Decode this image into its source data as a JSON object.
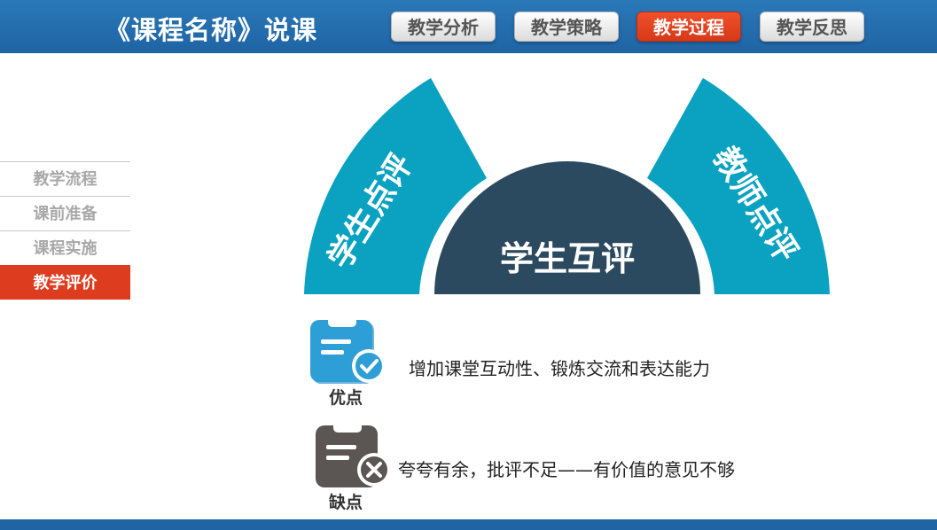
{
  "header": {
    "title": "《课程名称》说课",
    "nav": [
      {
        "label": "教学分析",
        "active": false
      },
      {
        "label": "教学策略",
        "active": false
      },
      {
        "label": "教学过程",
        "active": true
      },
      {
        "label": "教学反思",
        "active": false
      }
    ]
  },
  "sidebar": {
    "items": [
      {
        "label": "教学流程",
        "active": false
      },
      {
        "label": "课前准备",
        "active": false
      },
      {
        "label": "课程实施",
        "active": false
      },
      {
        "label": "教学评价",
        "active": true
      }
    ]
  },
  "diagram": {
    "left_segment": "学生点评",
    "center": "学生互评",
    "right_segment": "教师点评"
  },
  "evaluation": {
    "pros": {
      "label": "优点",
      "icon": "clipboard-check-icon",
      "text": "增加课堂互动性、锻炼交流和表达能力"
    },
    "cons": {
      "label": "缺点",
      "icon": "clipboard-x-icon",
      "text": "夸夸有余，批评不足——有价值的意见不够"
    }
  },
  "colors": {
    "header_blue": "#1f64a4",
    "accent_red": "#de3c1e",
    "teal": "#0aa2c0",
    "navy": "#2c4a5f"
  }
}
